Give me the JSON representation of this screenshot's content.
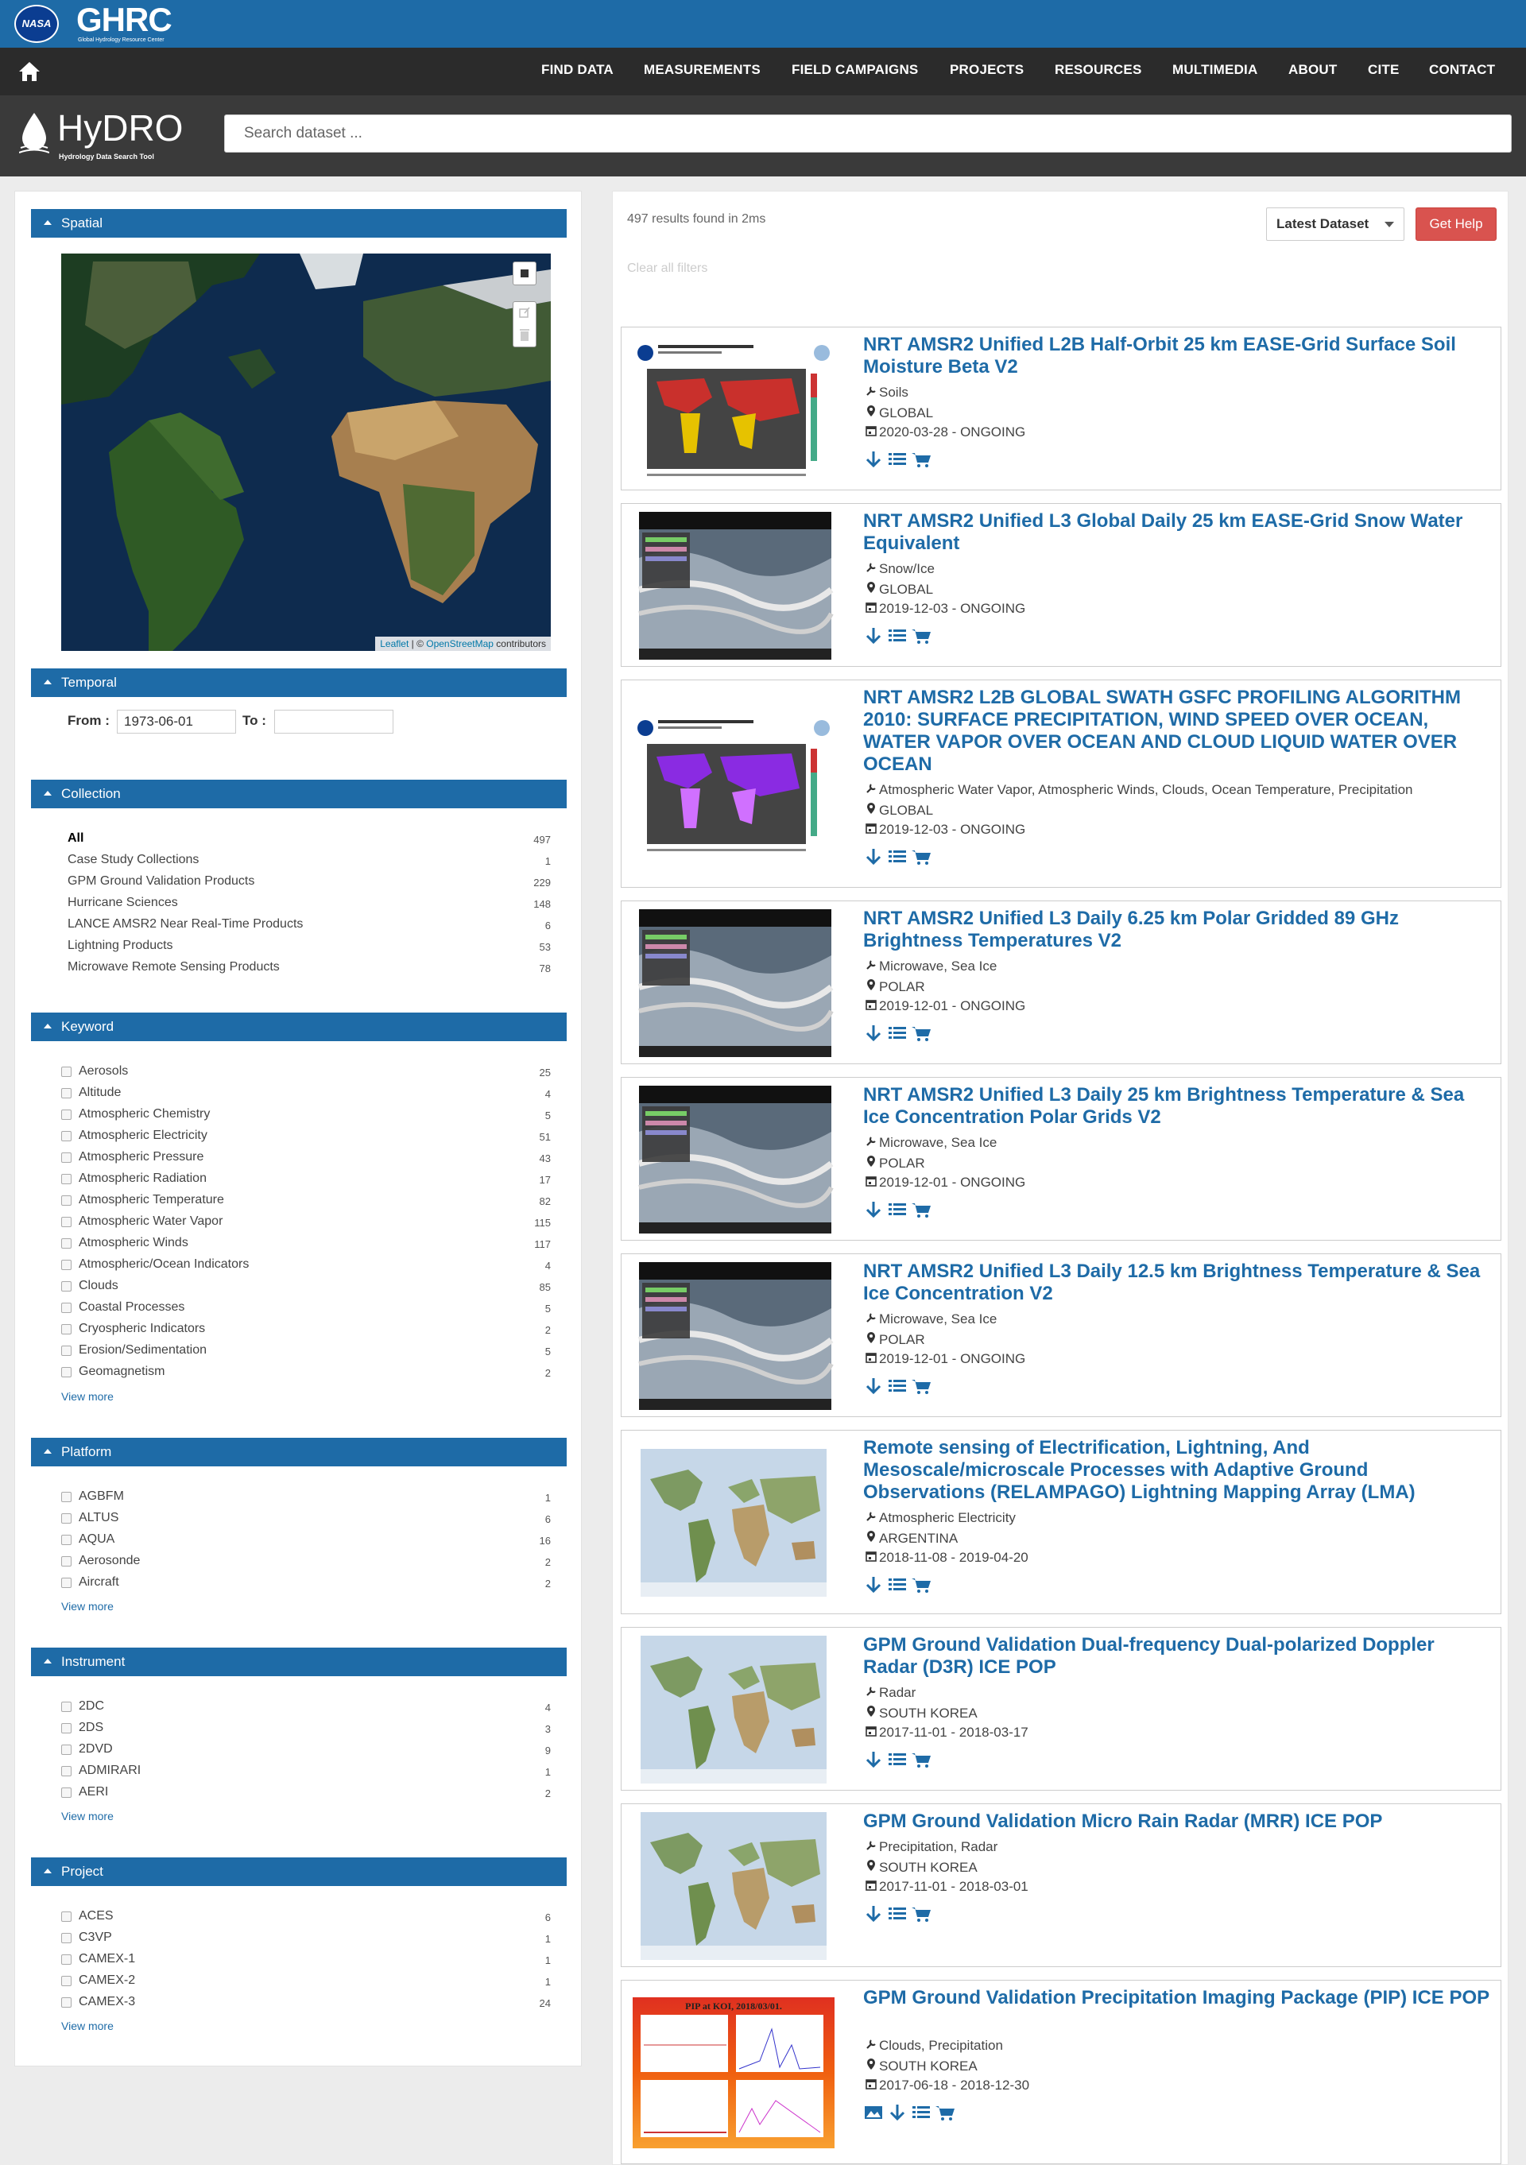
{
  "header": {
    "nasa": "NASA",
    "ghrc": "GHRC",
    "ghrc_sub": "Global Hydrology Resource Center"
  },
  "nav": [
    "FIND DATA",
    "MEASUREMENTS",
    "FIELD CAMPAIGNS",
    "PROJECTS",
    "RESOURCES",
    "MULTIMEDIA",
    "ABOUT",
    "CITE",
    "CONTACT"
  ],
  "hydro": {
    "name": "HyDRO",
    "sub": "Hydrology Data Search Tool",
    "search_placeholder": "Search dataset ..."
  },
  "sections": {
    "spatial": "Spatial",
    "temporal": "Temporal",
    "collection": "Collection",
    "keyword": "Keyword",
    "platform": "Platform",
    "instrument": "Instrument",
    "project": "Project"
  },
  "map": {
    "leaflet": "Leaflet",
    "sep": " | © ",
    "osm": "OpenStreetMap",
    "contrib": " contributors"
  },
  "temporal": {
    "from_label": "From :",
    "from_value": "1973-06-01",
    "to_label": "To :",
    "to_value": ""
  },
  "collection": [
    {
      "label": "All",
      "count": "497"
    },
    {
      "label": "Case Study Collections",
      "count": "1"
    },
    {
      "label": "GPM Ground Validation Products",
      "count": "229"
    },
    {
      "label": "Hurricane Sciences",
      "count": "148"
    },
    {
      "label": "LANCE AMSR2 Near Real-Time Products",
      "count": "6"
    },
    {
      "label": "Lightning Products",
      "count": "53"
    },
    {
      "label": "Microwave Remote Sensing Products",
      "count": "78"
    }
  ],
  "keyword": [
    {
      "label": "Aerosols",
      "count": "25"
    },
    {
      "label": "Altitude",
      "count": "4"
    },
    {
      "label": "Atmospheric Chemistry",
      "count": "5"
    },
    {
      "label": "Atmospheric Electricity",
      "count": "51"
    },
    {
      "label": "Atmospheric Pressure",
      "count": "43"
    },
    {
      "label": "Atmospheric Radiation",
      "count": "17"
    },
    {
      "label": "Atmospheric Temperature",
      "count": "82"
    },
    {
      "label": "Atmospheric Water Vapor",
      "count": "115"
    },
    {
      "label": "Atmospheric Winds",
      "count": "117"
    },
    {
      "label": "Atmospheric/Ocean Indicators",
      "count": "4"
    },
    {
      "label": "Clouds",
      "count": "85"
    },
    {
      "label": "Coastal Processes",
      "count": "5"
    },
    {
      "label": "Cryospheric Indicators",
      "count": "2"
    },
    {
      "label": "Erosion/Sedimentation",
      "count": "5"
    },
    {
      "label": "Geomagnetism",
      "count": "2"
    }
  ],
  "platform": [
    {
      "label": "AGBFM",
      "count": "1"
    },
    {
      "label": "ALTUS",
      "count": "6"
    },
    {
      "label": "AQUA",
      "count": "16"
    },
    {
      "label": "Aerosonde",
      "count": "2"
    },
    {
      "label": "Aircraft",
      "count": "2"
    }
  ],
  "instrument": [
    {
      "label": "2DC",
      "count": "4"
    },
    {
      "label": "2DS",
      "count": "3"
    },
    {
      "label": "2DVD",
      "count": "9"
    },
    {
      "label": "ADMIRARI",
      "count": "1"
    },
    {
      "label": "AERI",
      "count": "2"
    }
  ],
  "project": [
    {
      "label": "ACES",
      "count": "6"
    },
    {
      "label": "C3VP",
      "count": "1"
    },
    {
      "label": "CAMEX-1",
      "count": "1"
    },
    {
      "label": "CAMEX-2",
      "count": "1"
    },
    {
      "label": "CAMEX-3",
      "count": "24"
    }
  ],
  "view_more": "View more",
  "results": {
    "count_text": "497 results found in 2ms",
    "clear": "Clear all filters",
    "sort": "Latest Dataset",
    "help": "Get Help"
  },
  "cards": [
    {
      "title": "NRT AMSR2 Unified L2B Half-Orbit 25 km EASE-Grid Surface Soil Moisture Beta V2",
      "keywords": "Soils",
      "region": "GLOBAL",
      "dates": "2020-03-28 - ONGOING",
      "thumb": "soil-moisture-map"
    },
    {
      "title": "NRT AMSR2 Unified L3 Global Daily 25 km EASE-Grid Snow Water Equivalent",
      "keywords": "Snow/Ice",
      "region": "GLOBAL",
      "dates": "2019-12-03 - ONGOING",
      "thumb": "worldview-screenshot"
    },
    {
      "title": "NRT AMSR2 L2B GLOBAL SWATH GSFC PROFILING ALGORITHM 2010: SURFACE PRECIPITATION, WIND SPEED OVER OCEAN, WATER VAPOR OVER OCEAN AND CLOUD LIQUID WATER OVER OCEAN",
      "keywords": "Atmospheric Water Vapor, Atmospheric Winds, Clouds, Ocean Temperature, Precipitation",
      "region": "GLOBAL",
      "dates": "2019-12-03 - ONGOING",
      "thumb": "cloud-liquid-water-map"
    },
    {
      "title": "NRT AMSR2 Unified L3 Daily 6.25 km Polar Gridded 89 GHz Brightness Temperatures V2",
      "keywords": "Microwave, Sea Ice",
      "region": "POLAR",
      "dates": "2019-12-01 - ONGOING",
      "thumb": "worldview-screenshot"
    },
    {
      "title": "NRT AMSR2 Unified L3 Daily 25 km Brightness Temperature & Sea Ice Concentration Polar Grids V2",
      "keywords": "Microwave, Sea Ice",
      "region": "POLAR",
      "dates": "2019-12-01 - ONGOING",
      "thumb": "worldview-screenshot"
    },
    {
      "title": "NRT AMSR2 Unified L3 Daily 12.5 km Brightness Temperature & Sea Ice Concentration V2",
      "keywords": "Microwave, Sea Ice",
      "region": "POLAR",
      "dates": "2019-12-01 - ONGOING",
      "thumb": "worldview-screenshot"
    },
    {
      "title": "Remote sensing of Electrification, Lightning, And Mesoscale/microscale Processes with Adaptive Ground Observations (RELAMPAGO) Lightning Mapping Array (LMA)",
      "keywords": "Atmospheric Electricity",
      "region": "ARGENTINA",
      "dates": "2018-11-08 - 2019-04-20",
      "thumb": "world-map"
    },
    {
      "title": "GPM Ground Validation Dual-frequency Dual-polarized Doppler Radar (D3R) ICE POP",
      "keywords": "Radar",
      "region": "SOUTH KOREA",
      "dates": "2017-11-01 - 2018-03-17",
      "thumb": "world-map"
    },
    {
      "title": "GPM Ground Validation Micro Rain Radar (MRR) ICE POP",
      "keywords": "Precipitation, Radar",
      "region": "SOUTH KOREA",
      "dates": "2017-11-01 - 2018-03-01",
      "thumb": "world-map"
    },
    {
      "title": "GPM Ground Validation Precipitation Imaging Package (PIP) ICE POP",
      "keywords": "Clouds, Precipitation",
      "region": "SOUTH KOREA",
      "dates": "2017-06-18 - 2018-12-30",
      "thumb": "pip-plot",
      "pip_title": "PIP at KOI, 2018/03/01."
    }
  ]
}
